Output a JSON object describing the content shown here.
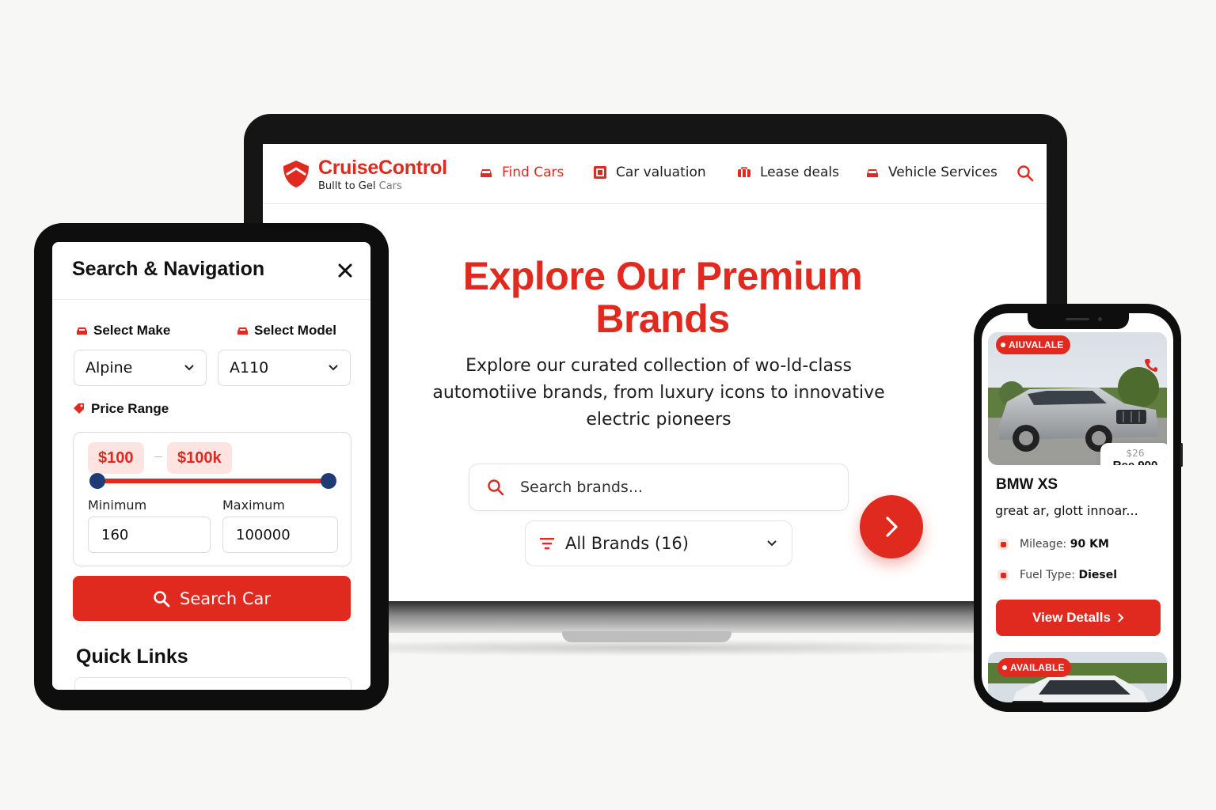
{
  "laptop": {
    "brand": {
      "name": "CruiseControl",
      "tagline_main": "Bullt to Gel",
      "tagline_accent": "Cars"
    },
    "nav": [
      {
        "label": "Find Cars",
        "icon": "car-icon",
        "active": true
      },
      {
        "label": "Car valuation",
        "icon": "calculator-icon",
        "active": false
      },
      {
        "label": "Lease deals",
        "icon": "briefcase-icon",
        "active": false
      },
      {
        "label": "Vehicle Services",
        "icon": "car-icon",
        "active": false
      }
    ],
    "search_icon": "search-icon",
    "hero": {
      "title_line1": "Explore Our Premium",
      "title_line2": "Brands",
      "subtitle_line1": "Explore our curated collection of wo-ld-class",
      "subtitle_line2": "automotiive brands, from luxury icons to innovative",
      "subtitle_line3": "electric pioneers"
    },
    "brand_search": {
      "placeholder": "Search brands..."
    },
    "brand_filter": {
      "value": "All Brands (16)"
    },
    "go_button_icon": "chevron-right-icon"
  },
  "tablet": {
    "title": "Search & Navigation",
    "close_icon": "close-icon",
    "make": {
      "label": "Select Make",
      "value": "Alpine"
    },
    "model": {
      "label": "Select Model",
      "value": "A110"
    },
    "price_range": {
      "label": "Price Range",
      "min_display": "$100",
      "max_display": "$100k",
      "min_label": "Minimum",
      "max_label": "Maximum",
      "min_value": "160",
      "max_value": "100000"
    },
    "search_button": "Search Car",
    "quick_links": "Quick Links"
  },
  "phone": {
    "badge_top": "AIUVALALE",
    "price_old": "$26",
    "price_new": "Ree 900",
    "car_title": "BMW XS",
    "car_desc": "great   ar, glott innoar...",
    "mileage_label": "Mileage:",
    "mileage_value": "90 KM",
    "fuel_label": "Fuel Type:",
    "fuel_value": "Diesel",
    "view_details": "View Detalls",
    "badge_bottom": "AVAILABLE"
  },
  "colors": {
    "accent": "#e02a1f",
    "slider_thumb": "#1f3b75",
    "pill_bg": "#fde4e1"
  }
}
